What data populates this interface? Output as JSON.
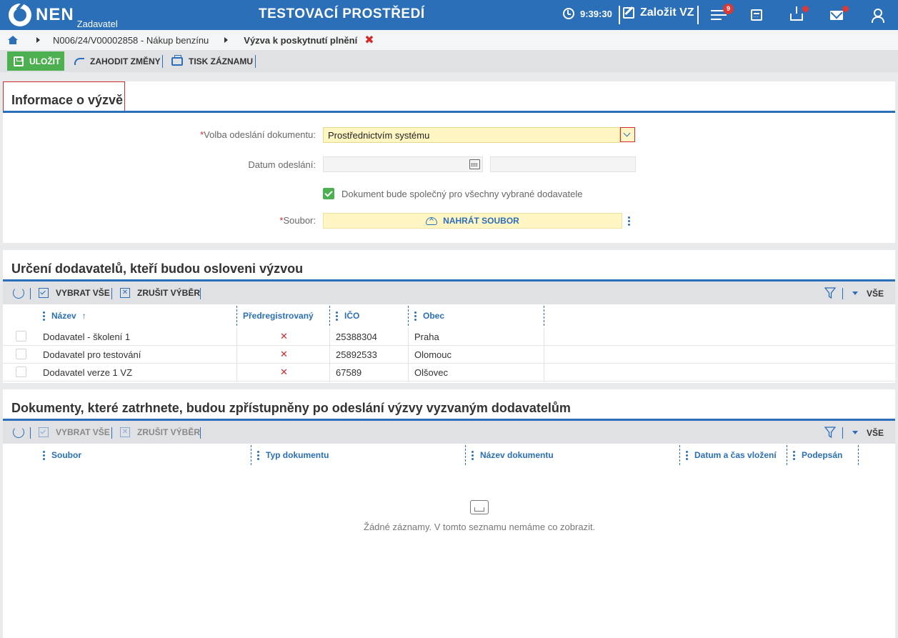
{
  "header": {
    "logo_text": "NEN",
    "logo_sub": "Zadavatel",
    "environment": "TESTOVACÍ PROSTŘEDÍ",
    "time": "9:39:30",
    "create_label": "Založit VZ",
    "menu_badge": "9",
    "icons": [
      "clock-icon",
      "edit-icon",
      "menu-icon",
      "calculator-icon",
      "inbox-icon",
      "mail-icon",
      "user-icon"
    ],
    "colors": {
      "bar": "#2a6fb8",
      "badge": "#d93a35"
    }
  },
  "breadcrumb": {
    "item1": "N006/24/V00002858 - Nákup benzínu",
    "item2": "Výzva k poskytnutí plnění",
    "close": "✖"
  },
  "toolbar": {
    "save_label": "ULOŽIT",
    "discard_label": "ZAHODIT ZMĚNY",
    "print_label": "TISK ZÁZNAMU"
  },
  "info": {
    "title": "Informace o výzvě",
    "send_label": "Volba odeslání dokumentu:",
    "send_value": "Prostřednictvím systému",
    "date_label": "Datum odeslání:",
    "date_value": "",
    "time_value": "",
    "common_label": "Dokument bude společný pro všechny vybrané dodavatele",
    "common_checked": true,
    "file_label": "Soubor:",
    "upload_label": "NAHRÁT SOUBOR",
    "required_mark": "*"
  },
  "suppliers": {
    "title": "Určení dodavatelů, kteří budou osloveni výzvou",
    "select_all": "VYBRAT VŠE",
    "deselect": "ZRUŠIT VÝBĚR",
    "all": "VŠE",
    "columns": [
      "Název",
      "Předregistrovaný",
      "IČO",
      "Obec"
    ],
    "sort_indicator": "↑",
    "rows": [
      {
        "name": "Dodavatel - školení 1",
        "prereg": "✕",
        "ico": "25388304",
        "city": "Praha"
      },
      {
        "name": "Dodavatel pro testování",
        "prereg": "✕",
        "ico": "25892533",
        "city": "Olomouc"
      },
      {
        "name": "Dodavatel verze 1 VZ",
        "prereg": "✕",
        "ico": "67589",
        "city": "Olšovec"
      }
    ]
  },
  "documents": {
    "title": "Dokumenty, které zatrhnete, budou zpřístupněny po odeslání výzvy vyzvaným dodavatelům",
    "select_all": "VYBRAT VŠE",
    "deselect": "ZRUŠIT VÝBĚR",
    "all": "VŠE",
    "columns": [
      "Soubor",
      "Typ dokumentu",
      "Název dokumentu",
      "Datum a čas vložení",
      "Podepsán"
    ],
    "empty_text": "Žádné záznamy. V tomto seznamu nemáme co zobrazit."
  }
}
